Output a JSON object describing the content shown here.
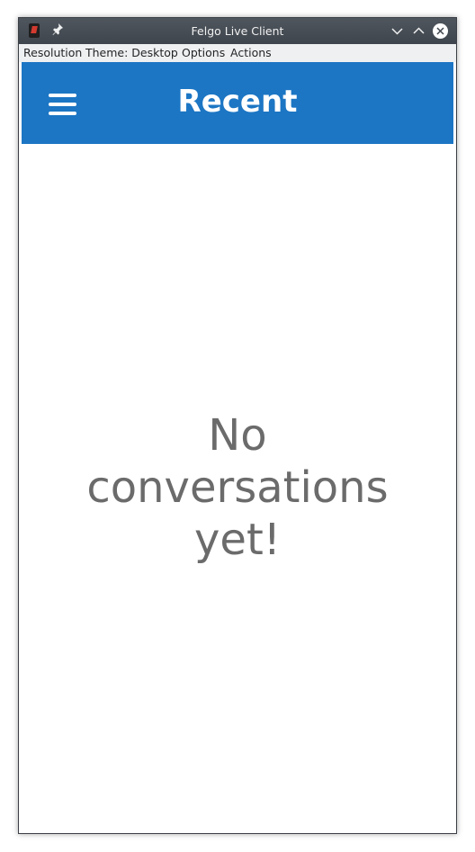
{
  "window": {
    "title": "Felgo Live Client"
  },
  "menubar": {
    "items": [
      "Resolution",
      "Theme: Desktop",
      "Options",
      "Actions"
    ]
  },
  "navbar": {
    "title": "Recent",
    "menu_icon": "hamburger-menu-icon",
    "color": "#1c76c4"
  },
  "content": {
    "empty_message": "No conversations yet!"
  }
}
